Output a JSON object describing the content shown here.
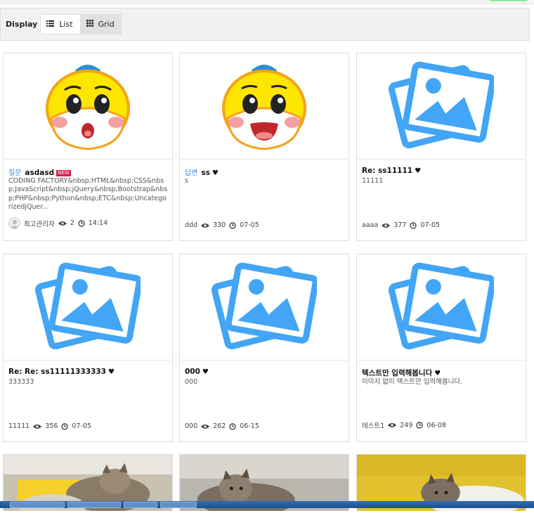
{
  "toolbar": {
    "display_label": "Display",
    "list_label": "List",
    "grid_label": "Grid"
  },
  "cards": [
    {
      "category": "질문",
      "title": "asdasd",
      "badge": "NEW",
      "excerpt": "CODING FACTORY&nbsp;HTML&nbsp;CSS&nbsp;JavaScript&nbsp;jQuery&nbsp;Bootstrap&nbsp;PHP&nbsp;Python&nbsp;ETC&nbsp;UncategorizedjQuer...",
      "author": "최고관리자",
      "views": "2",
      "date": "14:14",
      "image": "mascot-worried"
    },
    {
      "category": "답변",
      "title": "ss",
      "excerpt": "s",
      "author": "ddd",
      "views": "330",
      "date": "07-05",
      "image": "mascot-happy"
    },
    {
      "category": "",
      "title": "Re: ss11111",
      "excerpt": "11111",
      "author": "aaaa",
      "views": "377",
      "date": "07-05",
      "image": "placeholder-image"
    },
    {
      "category": "",
      "title": "Re: Re: ss11111333333",
      "excerpt": "333333",
      "author": "11111",
      "views": "356",
      "date": "07-05",
      "image": "placeholder-image"
    },
    {
      "category": "",
      "title": "000",
      "excerpt": "000",
      "author": "000",
      "views": "262",
      "date": "06-15",
      "image": "placeholder-image"
    },
    {
      "category": "",
      "title": "텍스트만 입력해봅니다",
      "excerpt": "이미지 없이 텍스트만 입력해봅니다.",
      "author": "테스트1",
      "views": "249",
      "date": "06-08",
      "image": "placeholder-image"
    }
  ],
  "colors": {
    "accent_blue": "#3a8ed6",
    "placeholder_blue": "#42a5f5",
    "new_badge": "#d81b4f",
    "mascot_yellow": "#ffe600"
  }
}
